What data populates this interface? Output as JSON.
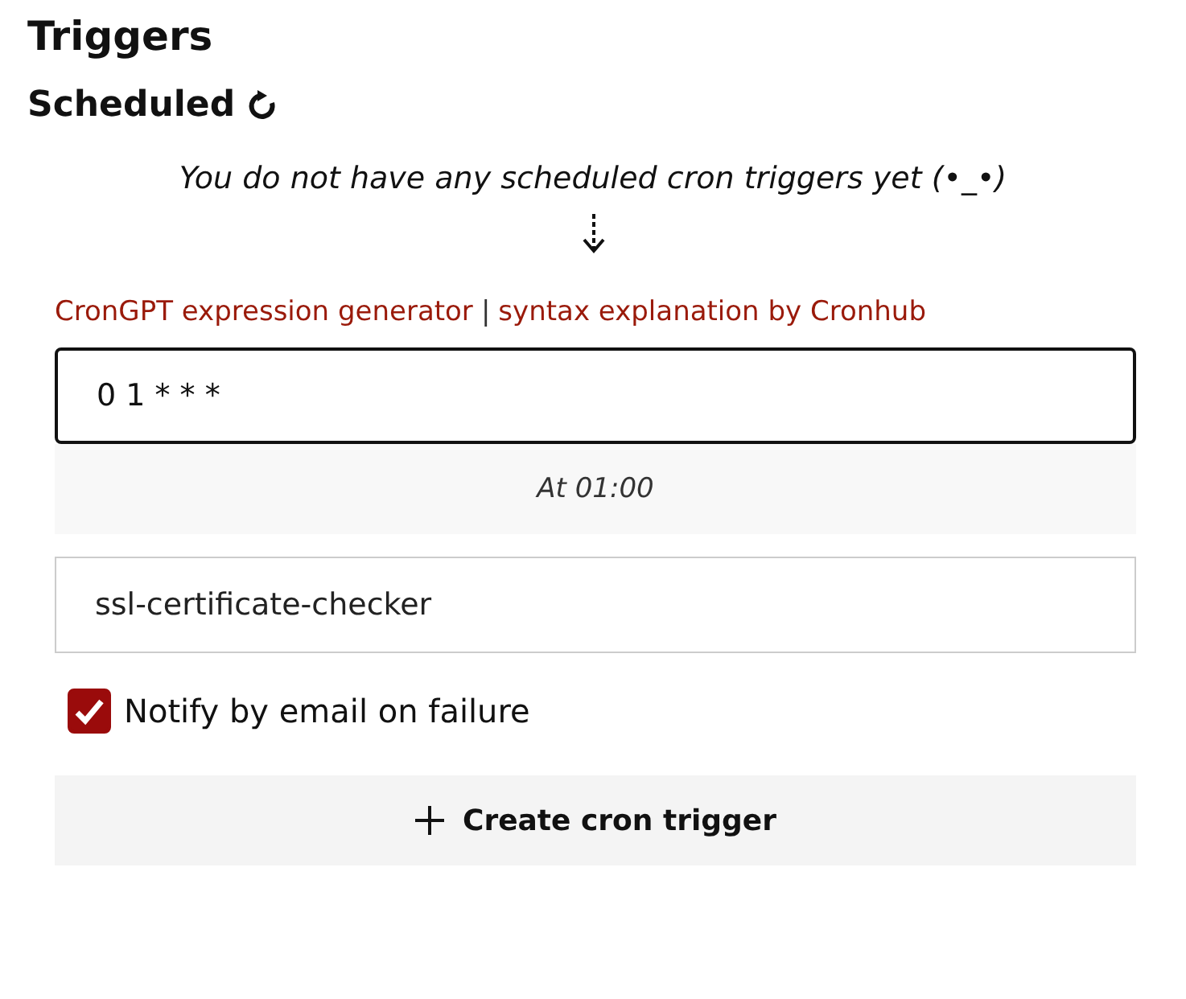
{
  "title": "Triggers",
  "section": {
    "title": "Scheduled",
    "empty_message": "You do not have any scheduled cron triggers yet (•_•)"
  },
  "links": [
    {
      "label": "CronGPT expression generator"
    },
    {
      "label": "syntax explanation by Cronhub"
    }
  ],
  "link_separator": "|",
  "cron_field": {
    "value": "0 1 * * *"
  },
  "cron_description": "At 01:00",
  "name_field": {
    "value": "ssl-certificate-checker"
  },
  "notify": {
    "label": "Notify by email on failure",
    "checked": true
  },
  "create_button": {
    "label": "Create cron trigger"
  }
}
